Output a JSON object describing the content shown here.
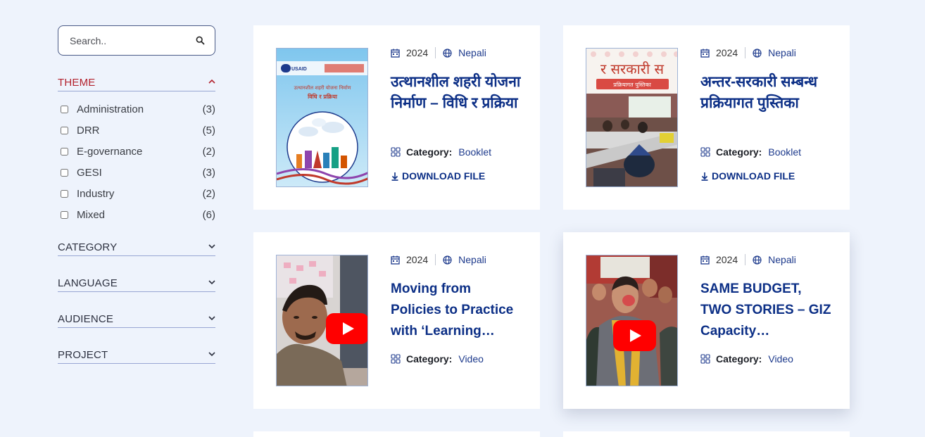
{
  "search": {
    "placeholder": "Search.."
  },
  "filters": {
    "theme": {
      "title": "THEME",
      "options": [
        {
          "label": "Administration",
          "count": "(3)"
        },
        {
          "label": "DRR",
          "count": "(5)"
        },
        {
          "label": "E-governance",
          "count": "(2)"
        },
        {
          "label": "GESI",
          "count": "(3)"
        },
        {
          "label": "Industry",
          "count": "(2)"
        },
        {
          "label": "Mixed",
          "count": "(6)"
        }
      ]
    },
    "category": {
      "title": "CATEGORY"
    },
    "language": {
      "title": "LANGUAGE"
    },
    "audience": {
      "title": "AUDIENCE"
    },
    "project": {
      "title": "PROJECT"
    }
  },
  "cards": [
    {
      "year": "2024",
      "language": "Nepali",
      "title": "उत्थानशील शहरी योजना निर्माण – विधि र प्रक्रिया",
      "category_label": "Category:",
      "category": "Booklet",
      "download": "DOWNLOAD FILE",
      "thumb": {
        "logo": "USAID",
        "cover_title": "उत्थानशील शहरी योजना निर्माण",
        "cover_sub": "विधि र प्रक्रिया"
      }
    },
    {
      "year": "2024",
      "language": "Nepali",
      "title": "अन्तर-सरकारी सम्बन्ध प्रक्रियागत पुस्तिका",
      "category_label": "Category:",
      "category": "Booklet",
      "download": "DOWNLOAD FILE",
      "thumb": {
        "cover_title": "र सरकारी स",
        "cover_sub": "प्रक्रियागत पुस्तिका"
      }
    },
    {
      "year": "2024",
      "language": "Nepali",
      "title": "Moving from Policies to Practice with ‘Learning…",
      "category_label": "Category:",
      "category": "Video"
    },
    {
      "year": "2024",
      "language": "Nepali",
      "title": "SAME BUDGET, TWO STORIES – GIZ Capacity…",
      "category_label": "Category:",
      "category": "Video"
    }
  ],
  "colors": {
    "accent": "#0c2f86",
    "theme_active": "#b3232e",
    "background": "#eef3fc",
    "play": "#ff0000"
  }
}
